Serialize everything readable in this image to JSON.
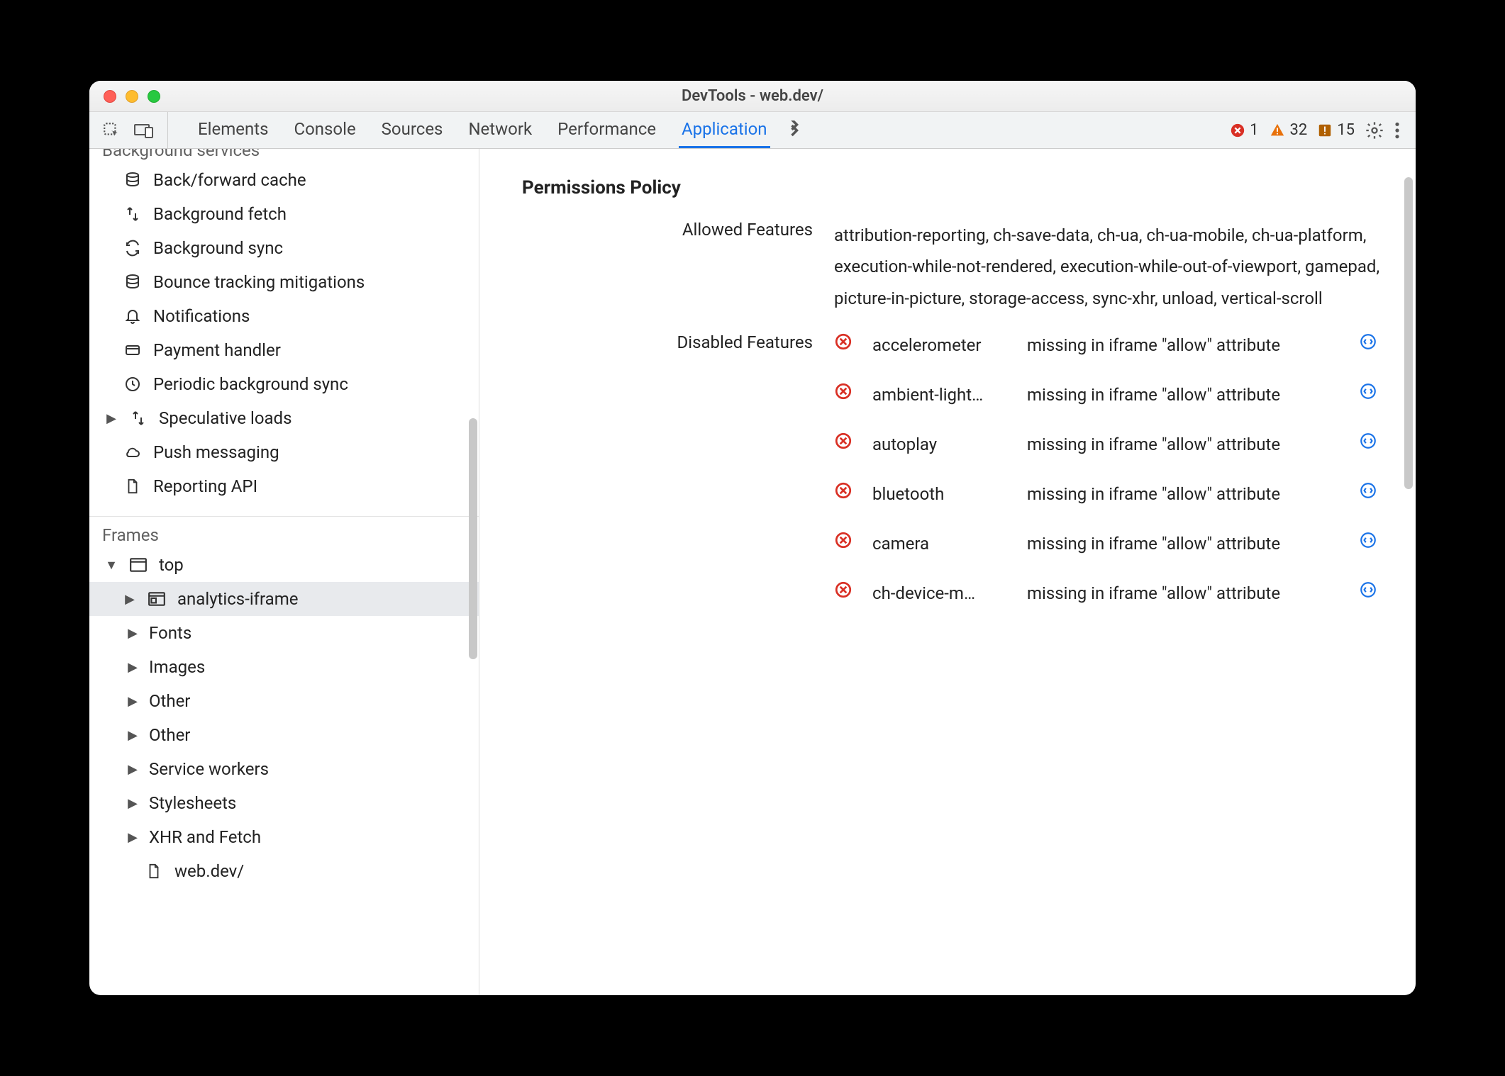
{
  "window": {
    "title": "DevTools - web.dev/"
  },
  "toolbar": {
    "tabs": [
      "Elements",
      "Console",
      "Sources",
      "Network",
      "Performance",
      "Application"
    ],
    "active_tab": "Application",
    "errors": "1",
    "warnings": "32",
    "issues": "15"
  },
  "sidebar": {
    "section_bg_services": "Background services",
    "bg_services": [
      {
        "label": "Back/forward cache",
        "icon": "db"
      },
      {
        "label": "Background fetch",
        "icon": "fetch"
      },
      {
        "label": "Background sync",
        "icon": "sync"
      },
      {
        "label": "Bounce tracking mitigations",
        "icon": "db"
      },
      {
        "label": "Notifications",
        "icon": "bell"
      },
      {
        "label": "Payment handler",
        "icon": "card"
      },
      {
        "label": "Periodic background sync",
        "icon": "clock"
      },
      {
        "label": "Speculative loads",
        "icon": "fetch",
        "expandable": true
      },
      {
        "label": "Push messaging",
        "icon": "cloud"
      },
      {
        "label": "Reporting API",
        "icon": "doc"
      }
    ],
    "section_frames": "Frames",
    "frames": {
      "top_label": "top",
      "selected_label": "analytics-iframe",
      "children": [
        "Fonts",
        "Images",
        "Other",
        "Other",
        "Service workers",
        "Stylesheets",
        "XHR and Fetch"
      ],
      "leaf_label": "web.dev/"
    }
  },
  "main": {
    "panel_title": "Permissions Policy",
    "allowed_label": "Allowed Features",
    "allowed_value": "attribution-reporting, ch-save-data, ch-ua, ch-ua-mobile, ch-ua-platform, execution-while-not-rendered, execution-while-out-of-viewport, gamepad, picture-in-picture, storage-access, sync-xhr, unload, vertical-scroll",
    "disabled_label": "Disabled Features",
    "disabled": [
      {
        "feature": "accelerometer",
        "reason": "missing in iframe \"allow\" attribute"
      },
      {
        "feature": "ambient-light…",
        "reason": "missing in iframe \"allow\" attribute"
      },
      {
        "feature": "autoplay",
        "reason": "missing in iframe \"allow\" attribute"
      },
      {
        "feature": "bluetooth",
        "reason": "missing in iframe \"allow\" attribute"
      },
      {
        "feature": "camera",
        "reason": "missing in iframe \"allow\" attribute"
      },
      {
        "feature": "ch-device-m…",
        "reason": "missing in iframe \"allow\" attribute"
      }
    ]
  }
}
